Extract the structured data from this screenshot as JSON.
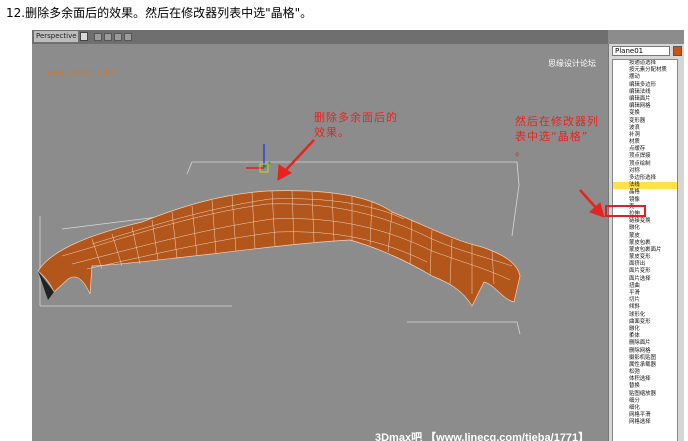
{
  "caption": "12.删除多余面后的效果。然后在修改器列表中选\"晶格\"。",
  "viewport": {
    "tab_label": "Perspective",
    "watermark": "WWW.3DXY.COM",
    "top_right_text": "思缘设计论坛",
    "annotation_left": [
      "删除多余面后的",
      "效果。"
    ],
    "annotation_right": [
      "然后在修改器列",
      "表中选“晶格”",
      "。"
    ],
    "footer_text": "3Dmax吧 【www.linecg.com/tieba/1771】"
  },
  "panel": {
    "object_name": "Plane01",
    "object_color": "#c9541a",
    "selected_index": 17,
    "modifiers": [
      "按通道选择",
      "按元素分配材质",
      "摆动",
      "编辑多边形",
      "编辑法线",
      "编辑面片",
      "编辑网格",
      "变换",
      "变形器",
      "波浪",
      "补洞",
      "材质",
      "点缓存",
      "顶点焊接",
      "顶点绘制",
      "对称",
      "多边形选择",
      "法线",
      "晶格",
      "镜像",
      "壳",
      "拉伸",
      "链接变换",
      "融化",
      "蒙皮",
      "蒙皮包裹",
      "蒙皮包裹面片",
      "蒙皮变形",
      "面挤出",
      "面片变形",
      "面片选择",
      "扭曲",
      "平滑",
      "切片",
      "倾斜",
      "球形化",
      "曲面变形",
      "融化",
      "柔体",
      "删除面片",
      "删除网格",
      "摄影机贴图",
      "属性承载器",
      "松弛",
      "体积选择",
      "替换",
      "贴图缩放器",
      "细分",
      "细化",
      "网格平滑",
      "网格选择"
    ]
  },
  "colors": {
    "accent_red": "#e8231f",
    "mesh_fill": "#b3561c",
    "highlight": "#ffe14a"
  }
}
